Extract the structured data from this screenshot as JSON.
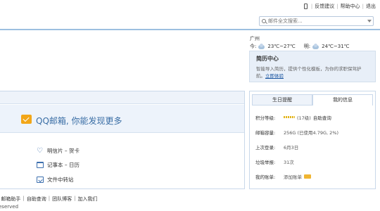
{
  "top_links": {
    "feedback": "反馈建议",
    "help": "帮助中心",
    "logout": "退出"
  },
  "search": {
    "placeholder": "邮件全文搜索..."
  },
  "weather": {
    "city": "广州",
    "today_label": "今:",
    "today_temp": "23℃~27℃",
    "tomorrow_label": "明:",
    "tomorrow_temp": "24℃~31℃"
  },
  "resume": {
    "title": "简历中心",
    "desc": "智能导入简历，提供个性化模板，为你的求职保驾护航。",
    "link": "立即体验"
  },
  "promo": {
    "text": "QQ邮箱, 你能发现更多"
  },
  "services": [
    {
      "label": "明信片 – 贺卡"
    },
    {
      "label": "记事本 – 日历"
    },
    {
      "label": "文件中转站"
    }
  ],
  "info_tabs": [
    "生日提醒",
    "我的信息"
  ],
  "info": {
    "level_label": "积分等级:",
    "level_value": "(17级)",
    "level_link": "自助查询",
    "capacity_label": "邮箱容量:",
    "capacity_value": "256G (已使用4.79G, 2%)",
    "last_login_label": "上次登录:",
    "last_login_value": "6月3日",
    "spam_label": "垃圾举报:",
    "spam_value": "31次",
    "account_label": "我的账单:",
    "account_value": "添加账单"
  },
  "footer": {
    "links": [
      "邮箱助手",
      "自助查询",
      "团队博客",
      "加入我们"
    ],
    "copyright": "eserved"
  }
}
